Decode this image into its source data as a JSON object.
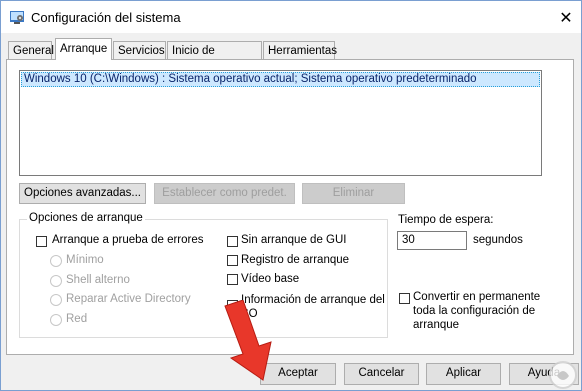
{
  "window": {
    "title": "Configuración del sistema",
    "close_glyph": "✕"
  },
  "tabs": [
    {
      "label": "General"
    },
    {
      "label": "Arranque"
    },
    {
      "label": "Servicios"
    },
    {
      "label": "Inicio de Windows"
    },
    {
      "label": "Herramientas"
    }
  ],
  "boot_list": {
    "items": [
      "Windows 10 (C:\\Windows) : Sistema operativo actual; Sistema operativo predeterminado"
    ]
  },
  "buttons": {
    "advanced": "Opciones avanzadas...",
    "set_default": "Establecer como predet.",
    "delete": "Eliminar"
  },
  "boot_options": {
    "title": "Opciones de arranque",
    "safe_boot": "Arranque a prueba de errores",
    "minimal": "Mínimo",
    "alt_shell": "Shell alterno",
    "ad_repair": "Reparar Active Directory",
    "network": "Red",
    "no_gui": "Sin arranque de GUI",
    "boot_log": "Registro de arranque",
    "base_video": "Vídeo base",
    "os_info_line1": "Información de arranque del",
    "os_info_line2": "SO"
  },
  "timeout": {
    "label": "Tiempo de espera:",
    "value": "30",
    "unit": "segundos"
  },
  "permanent": {
    "line1": "Convertir en permanente",
    "line2": "toda la configuración de",
    "line3": "arranque"
  },
  "footer": {
    "ok": "Aceptar",
    "cancel": "Cancelar",
    "apply": "Aplicar",
    "help": "Ayuda"
  },
  "colors": {
    "arrow": "#e8372a",
    "selection": "#cde8ff"
  },
  "icons": {
    "app": "msconfig-icon",
    "pointer": "red-arrow-annotation"
  }
}
